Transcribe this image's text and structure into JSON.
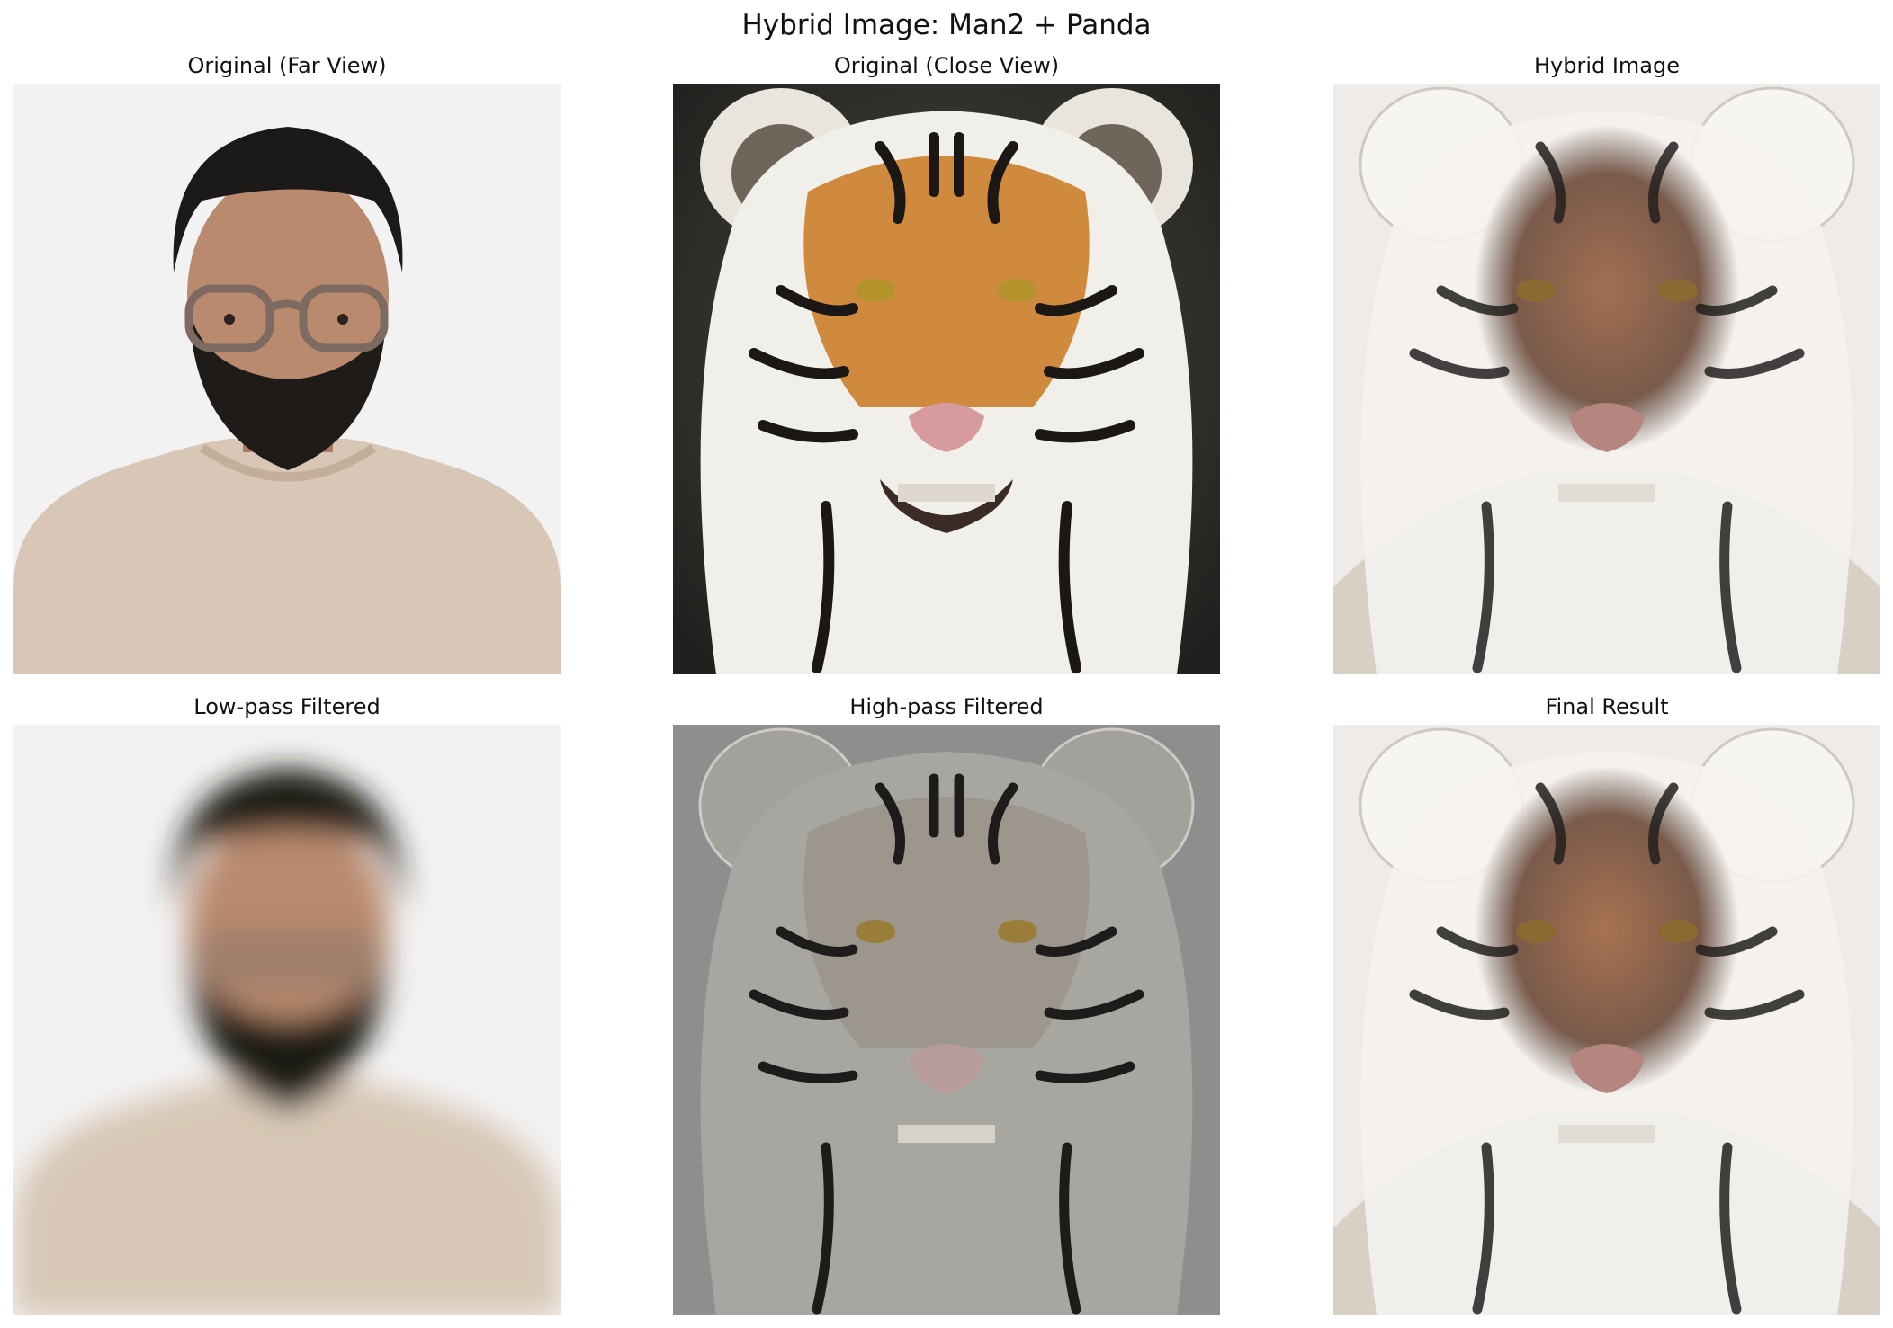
{
  "figure": {
    "title": "Hybrid Image: Man2 + Panda",
    "panels": [
      {
        "title": "Original (Far View)",
        "content": "man-portrait"
      },
      {
        "title": "Original (Close View)",
        "content": "tiger-portrait"
      },
      {
        "title": "Hybrid Image",
        "content": "hybrid-tiger-man"
      },
      {
        "title": "Low-pass Filtered",
        "content": "blurred-man-portrait"
      },
      {
        "title": "High-pass Filtered",
        "content": "gray-tiger-detail"
      },
      {
        "title": "Final Result",
        "content": "hybrid-tiger-man"
      }
    ]
  },
  "colors": {
    "far_background": "#f3f2f3",
    "shirt": "#d8c7b6",
    "skin": "#b98a6e",
    "hair": "#1c1a19",
    "tiger_orange": "#d08a3e",
    "tiger_dark_bg": "#2a2b28",
    "tiger_white": "#f1efea",
    "stripe": "#1a1715",
    "highpass_gray": "#8e8e8e",
    "hybrid_background": "#eeebe8"
  }
}
